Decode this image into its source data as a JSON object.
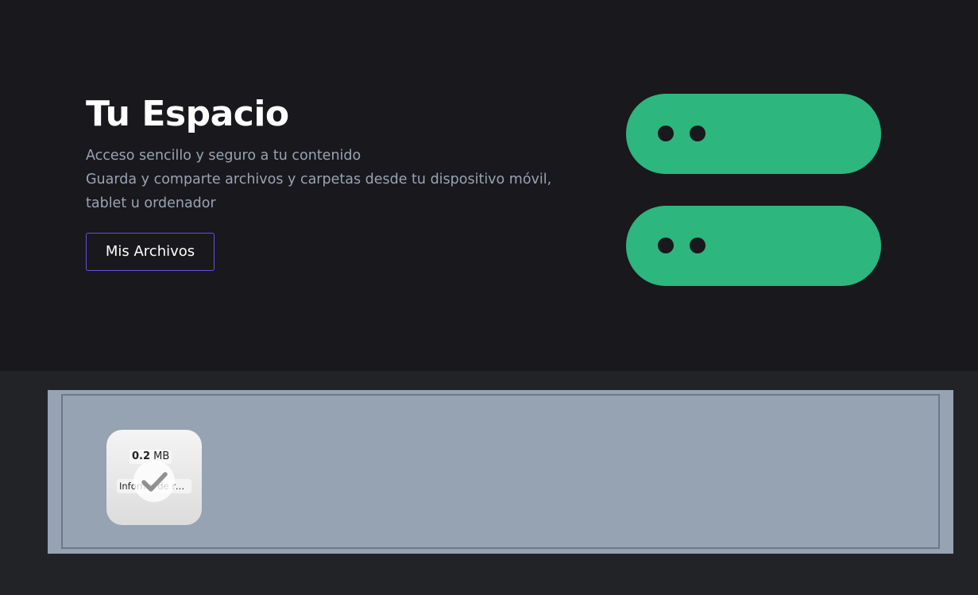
{
  "hero": {
    "title": "Tu Espacio",
    "subtitle": "Acceso sencillo y seguro a tu contenido",
    "description": "Guarda y comparte archivos y carpetas desde tu dispositivo móvil, tablet u ordenador",
    "button_label": "Mis Archivos"
  },
  "illustration": {
    "icon": "server-icon",
    "color": "#2db67d"
  },
  "dropzone": {
    "files": [
      {
        "size_value": "0.2",
        "size_unit": "MB",
        "name": "Informe de re...",
        "status_icon": "checkmark-icon"
      }
    ]
  },
  "colors": {
    "hero_background": "#18181d",
    "page_background": "#212327",
    "button_border": "#6a4fe0",
    "dropzone_background": "#95a3b3"
  }
}
